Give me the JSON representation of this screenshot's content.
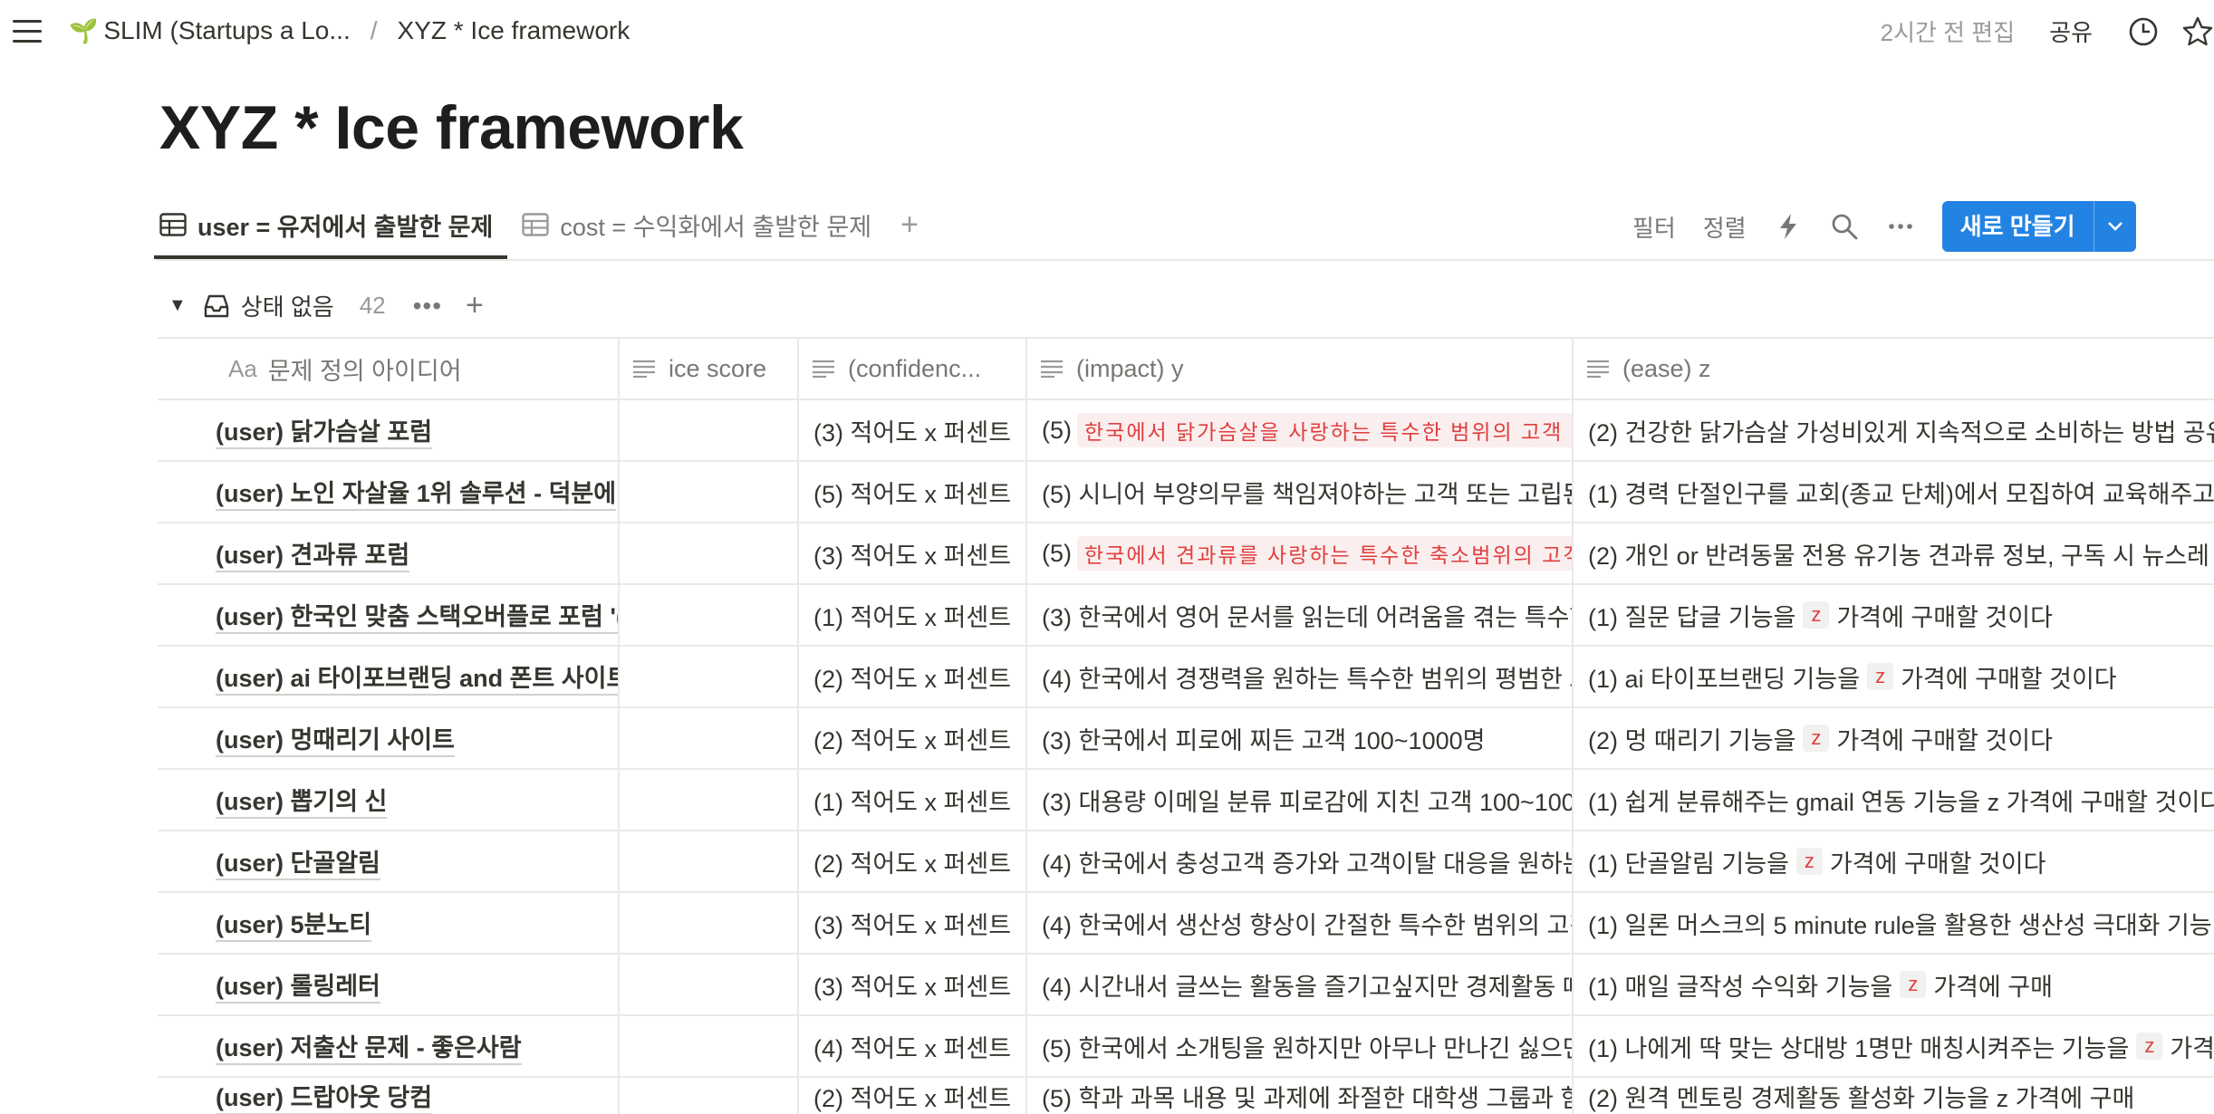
{
  "topbar": {
    "workspace": "SLIM (Startups a Lo...",
    "separator": "/",
    "page": "XYZ * Ice framework",
    "edited": "2시간 전 편집",
    "share": "공유"
  },
  "title": "XYZ * Ice framework",
  "tabs": [
    {
      "label": "user = 유저에서 출발한 문제",
      "active": true
    },
    {
      "label": "cost = 수익화에서 출발한 문제",
      "active": false
    }
  ],
  "toolbar": {
    "filter": "필터",
    "sort": "정렬",
    "new": "새로 만들기"
  },
  "group": {
    "title": "상태 없음",
    "count": "42"
  },
  "columns": {
    "c1": "문제 정의 아이디어",
    "c1_prefix": "Aa",
    "c2": "ice score",
    "c3": "(confidenc...",
    "c4": "(impact) y",
    "c5": "(ease) z"
  },
  "rows": [
    {
      "name": "(user) 닭가슴살 포럼",
      "score": "",
      "conf": "(3) 적어도 x 퍼센트",
      "impact_prefix": "(5)",
      "impact_chip": "한국에서 닭가슴살을 사랑하는 특수한 범위의 고객 1",
      "impact": "",
      "ease_before": "(2) 건강한 닭가슴살 가성비있게 지속적으로 소비하는 방법 공유",
      "ease_z": "",
      "ease_after": ""
    },
    {
      "name": "(user) 노인 자살율 1위 솔루션 - 덕분에",
      "score": "",
      "conf": "(5) 적어도 x 퍼센트",
      "impact_prefix": "",
      "impact_chip": "",
      "impact": "(5) 시니어 부양의무를 책임져야하는 고객 또는 고립된",
      "ease_before": "(1) 경력 단절인구를 교회(종교 단체)에서 모집하여 교육해주고",
      "ease_z": "",
      "ease_after": ""
    },
    {
      "name": "(user) 견과류 포럼",
      "score": "",
      "conf": "(3) 적어도 x 퍼센트",
      "impact_prefix": "(5)",
      "impact_chip": "한국에서 견과류를 사랑하는 특수한 축소범위의 고객",
      "impact": "",
      "ease_before": "(2) 개인 or 반려동물 전용 유기농 견과류 정보, 구독 시 뉴스레",
      "ease_z": "",
      "ease_after": ""
    },
    {
      "name": "(user) 한국인 맞춤 스택오버플로 포럼 '(",
      "score": "",
      "conf": "(1) 적어도 x 퍼센트",
      "impact_prefix": "",
      "impact_chip": "",
      "impact": "(3) 한국에서 영어 문서를 읽는데 어려움을 겪는 특수한",
      "ease_before": "(1) 질문 답글 기능을",
      "ease_z": "z",
      "ease_after": "가격에 구매할 것이다"
    },
    {
      "name": "(user) ai 타이포브랜딩 and 폰트 사이트",
      "score": "",
      "conf": "(2) 적어도 x 퍼센트",
      "impact_prefix": "",
      "impact_chip": "",
      "impact": "(4) 한국에서 경쟁력을 원하는 특수한 범위의 평범한 고",
      "ease_before": "(1) ai 타이포브랜딩 기능을",
      "ease_z": "z",
      "ease_after": "가격에 구매할 것이다"
    },
    {
      "name": "(user) 멍때리기 사이트",
      "score": "",
      "conf": "(2) 적어도 x 퍼센트",
      "impact_prefix": "",
      "impact_chip": "",
      "impact": "(3) 한국에서 피로에 찌든 고객 100~1000명",
      "ease_before": "(2) 멍 때리기 기능을",
      "ease_z": "z",
      "ease_after": "가격에 구매할 것이다"
    },
    {
      "name": "(user) 뽑기의 신",
      "score": "",
      "conf": "(1) 적어도 x 퍼센트",
      "impact_prefix": "",
      "impact_chip": "",
      "impact": "(3) 대용량 이메일 분류 피로감에 지친 고객 100~1000",
      "ease_before": "(1) 쉽게 분류해주는 gmail 연동 기능을 z 가격에 구매할 것이다",
      "ease_z": "",
      "ease_after": ""
    },
    {
      "name": "(user) 단골알림",
      "score": "",
      "conf": "(2) 적어도 x 퍼센트",
      "impact_prefix": "",
      "impact_chip": "",
      "impact": "(4) 한국에서 충성고객 증가와 고객이탈 대응을 원하는",
      "ease_before": "(1) 단골알림 기능을",
      "ease_z": "z",
      "ease_after": "가격에 구매할 것이다"
    },
    {
      "name": "(user) 5분노티",
      "score": "",
      "conf": "(3) 적어도 x 퍼센트",
      "impact_prefix": "",
      "impact_chip": "",
      "impact": "(4) 한국에서 생산성 향상이 간절한 특수한 범위의 고객",
      "ease_before": "(1) 일론 머스크의 5 minute rule을 활용한 생산성 극대화 기능",
      "ease_z": "",
      "ease_after": ""
    },
    {
      "name": "(user) 롤링레터",
      "score": "",
      "conf": "(3) 적어도 x 퍼센트",
      "impact_prefix": "",
      "impact_chip": "",
      "impact": "(4) 시간내서 글쓰는 활동을 즐기고싶지만 경제활동 때",
      "ease_before": "(1) 매일 글작성 수익화 기능을",
      "ease_z": "z",
      "ease_after": "가격에 구매"
    },
    {
      "name": "(user) 저출산 문제 - 좋은사람",
      "score": "",
      "conf": "(4) 적어도 x 퍼센트",
      "impact_prefix": "",
      "impact_chip": "",
      "impact": "(5) 한국에서 소개팅을 원하지만 아무나 만나긴 싫으면",
      "ease_before": "(1) 나에게 딱 맞는 상대방 1명만 매칭시켜주는 기능을",
      "ease_z": "z",
      "ease_after": "가격"
    },
    {
      "name": "(user) 드랍아웃 당컴",
      "score": "",
      "conf": "(2) 적어도 x 퍼센트",
      "impact_prefix": "",
      "impact_chip": "",
      "impact": "(5) 학과 과목 내용 및 과제에 좌절한 대학생 그룹과 함",
      "ease_before": "(2) 원격 멘토링 경제활동 활성화 기능을 z 가격에 구매",
      "ease_z": "",
      "ease_after": ""
    }
  ]
}
